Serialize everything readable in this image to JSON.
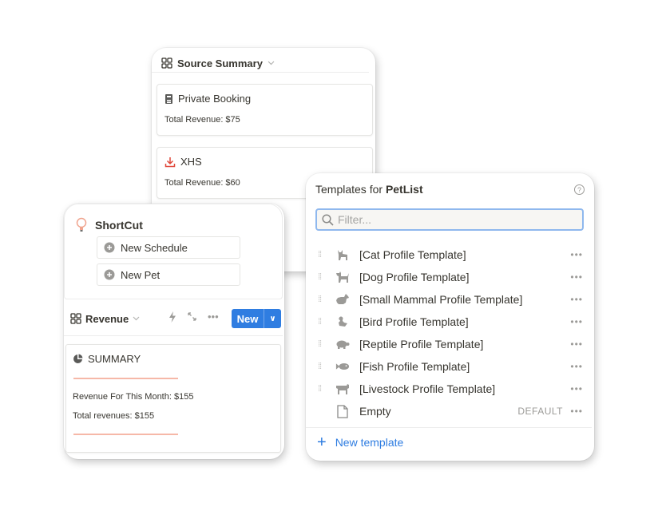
{
  "source_summary": {
    "title": "Source Summary",
    "cards": [
      {
        "icon": "booking-icon",
        "title": "Private Booking",
        "subtitle": "Total Revenue: $75"
      },
      {
        "icon": "download-icon",
        "title": "XHS",
        "subtitle": "Total Revenue: $60"
      }
    ]
  },
  "shortcut": {
    "title": "ShortCut",
    "buttons": [
      {
        "label": "New Schedule"
      },
      {
        "label": "New Pet"
      }
    ]
  },
  "revenue": {
    "view_title": "Revenue",
    "new_label": "New",
    "summary": {
      "title": "SUMMARY",
      "month_line": "Revenue For This Month: $155",
      "total_line": "Total revenues: $155"
    }
  },
  "templates": {
    "header_prefix": "Templates for",
    "header_db": "PetList",
    "filter_placeholder": "Filter...",
    "items": [
      {
        "icon": "cat",
        "label": "[Cat Profile Template]"
      },
      {
        "icon": "dog",
        "label": "[Dog Profile Template]"
      },
      {
        "icon": "rabbit",
        "label": "[Small Mammal Profile Template]"
      },
      {
        "icon": "bird",
        "label": "[Bird Profile Template]"
      },
      {
        "icon": "turtle",
        "label": "[Reptile Profile Template]"
      },
      {
        "icon": "fish",
        "label": "[Fish Profile Template]"
      },
      {
        "icon": "cow",
        "label": "[Livestock Profile Template]"
      }
    ],
    "empty_item": {
      "label": "Empty",
      "badge": "DEFAULT"
    },
    "new_template_label": "New template"
  },
  "colors": {
    "accent_blue": "#2f7de1",
    "summary_accent": "#f6b8a8",
    "xhs_red": "#e0483b"
  }
}
